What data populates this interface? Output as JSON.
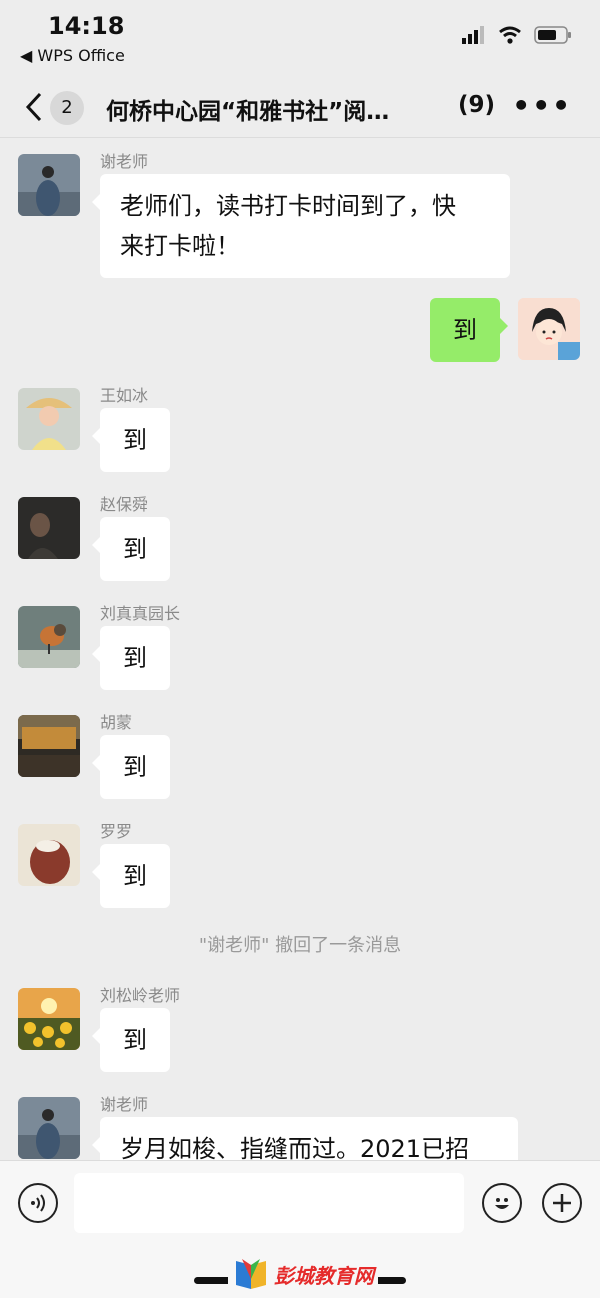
{
  "status_bar": {
    "time": "14:18",
    "back_app": "◀ WPS Office"
  },
  "nav": {
    "back_badge": "2",
    "title": "何桥中心园“和雅书社”阅…",
    "member_count": "(9)"
  },
  "messages": [
    {
      "sender": "谢老师",
      "lines": [
        "老师们，读书打卡时间到了，快",
        "来打卡啦！"
      ]
    },
    {
      "mine": true,
      "text": "到"
    },
    {
      "sender": "王如冰",
      "text": "到"
    },
    {
      "sender": "赵保舜",
      "text": "到"
    },
    {
      "sender": "刘真真园长",
      "text": "到"
    },
    {
      "sender": "胡蒙",
      "text": "到"
    },
    {
      "sender": "罗罗",
      "text": "到"
    },
    {
      "sender": "刘松岭老师",
      "text": "到"
    },
    {
      "sender": "谢老师",
      "text": "岁月如梭、指缝而过。2021已招"
    }
  ],
  "system_notice": "\"谢老师\" 撤回了一条消息",
  "input_bar": {
    "placeholder": ""
  },
  "watermark": {
    "text": "彭城教育网"
  },
  "colors": {
    "background": "#ededed",
    "my_bubble": "#95ec69",
    "other_bubble": "#ffffff",
    "watermark": "#e52b2b"
  }
}
